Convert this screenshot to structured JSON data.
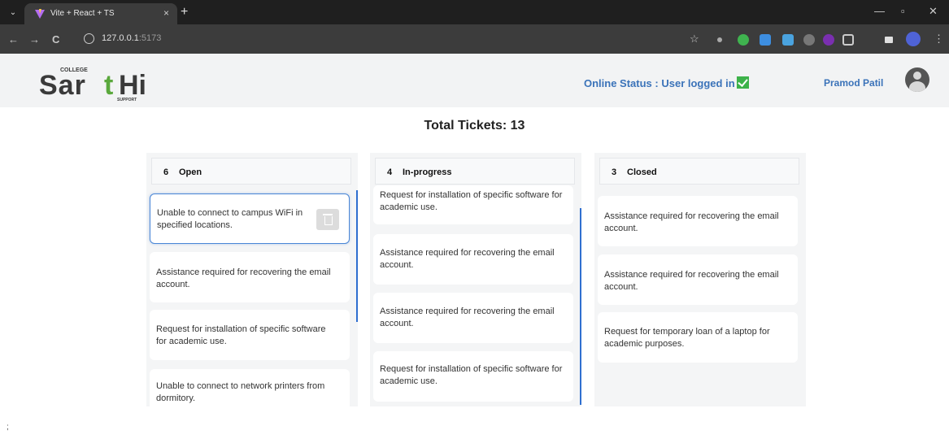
{
  "browser": {
    "tab_title": "Vite + React + TS",
    "tab_close": "×",
    "new_tab": "+",
    "url_host": "127.0.0.1",
    "url_port": ":5173",
    "back": "←",
    "forward": "→",
    "reload": "C",
    "menu": "⋮",
    "star": "☆",
    "minimize": "—",
    "restore": "▫",
    "close": "✕",
    "tab_list": "⌄"
  },
  "header": {
    "logo_text": "SarthI",
    "logo_small_top": "COLLEGE",
    "logo_small_bottom": "SUPPORT",
    "status_text": "Online Status : User logged in",
    "user_name": "Pramod Patil"
  },
  "total_tickets": "Total Tickets: 13",
  "columns": [
    {
      "count": "6",
      "title": "Open",
      "cards": [
        "Unable to connect to campus WiFi in specified locations.",
        "Assistance required for recovering the email account.",
        "Request for installation of specific software for academic use.",
        "Unable to connect to network printers from dormitory."
      ]
    },
    {
      "count": "4",
      "title": "In-progress",
      "cards": [
        "Request for installation of specific software for academic use.",
        "Assistance required for recovering the email account.",
        "Assistance required for recovering the email account.",
        "Request for installation of specific software for academic use."
      ]
    },
    {
      "count": "3",
      "title": "Closed",
      "cards": [
        "Assistance required for recovering the email account.",
        "Assistance required for recovering the email account.",
        "Request for temporary loan of a laptop for academic purposes."
      ]
    }
  ],
  "footer_char": ";",
  "colors": {
    "accent": "#3b73b9",
    "status_ok": "#3db24a",
    "logo_main": "#3a3a3a",
    "logo_accent": "#5aa83c"
  }
}
